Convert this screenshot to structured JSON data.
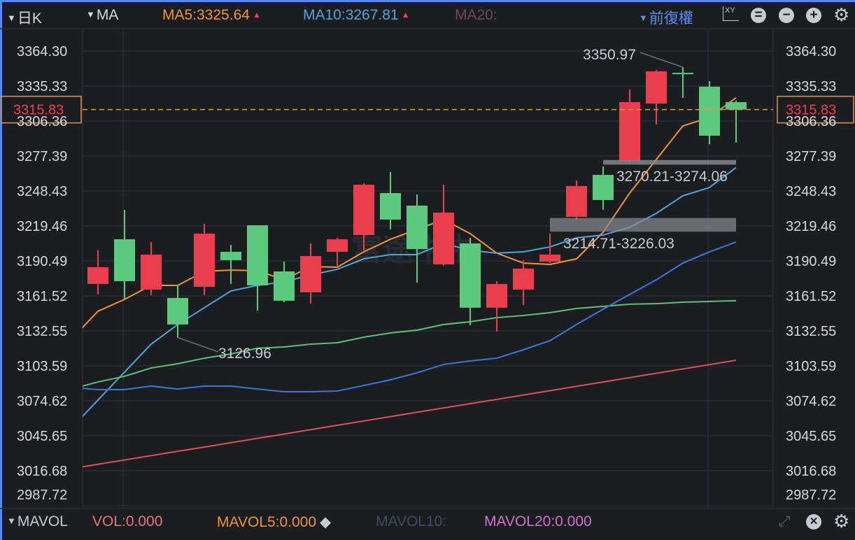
{
  "header": {
    "period": "日K",
    "indicator": "MA",
    "ma5": "MA5:3325.64",
    "ma10": "MA10:3267.81",
    "ma20": "MA20:",
    "adjust": "前復權",
    "xy_label": "XY"
  },
  "footer": {
    "indicator": "MAVOL",
    "vol": "VOL:0.000",
    "mavol5": "MAVOL5:0.000",
    "mavol10": "MAVOL10:",
    "mavol20": "MAVOL20:0.000"
  },
  "watermark": "富途牛牛",
  "colors": {
    "up": "#ea3d4d",
    "down": "#5dc97f",
    "ma5": "#f0943a",
    "ma10": "#4ea6dc",
    "ma20_label": "#6b4768",
    "accent": "#4c8cf5"
  },
  "chart_data": {
    "type": "candlestick",
    "ylim": [
      2987.72,
      3380.5
    ],
    "y_ticks": [
      "3364.30",
      "3335.33",
      "3306.36",
      "3277.39",
      "3248.43",
      "3219.46",
      "3190.49",
      "3161.52",
      "3132.55",
      "3103.59",
      "3074.62",
      "3045.65",
      "3016.68",
      "2987.72"
    ],
    "current_price": "3315.83",
    "candles": [
      {
        "o": 3171.4,
        "c": 3185.3,
        "h": 3199.2,
        "l": 3162.7
      },
      {
        "o": 3208.4,
        "c": 3173.7,
        "h": 3232.8,
        "l": 3158.6
      },
      {
        "o": 3166.7,
        "c": 3195.7,
        "h": 3206.1,
        "l": 3162.1
      },
      {
        "o": 3159.8,
        "c": 3137.8,
        "h": 3170.8,
        "l": 3126.96
      },
      {
        "o": 3169.0,
        "c": 3213.1,
        "h": 3221.2,
        "l": 3162.1
      },
      {
        "o": 3198.0,
        "c": 3191.1,
        "h": 3203.8,
        "l": 3171.4
      },
      {
        "o": 3220.0,
        "c": 3170.2,
        "h": 3220.0,
        "l": 3149.3
      },
      {
        "o": 3181.8,
        "c": 3157.5,
        "h": 3189.9,
        "l": 3156.3
      },
      {
        "o": 3164.4,
        "c": 3194.5,
        "h": 3205.0,
        "l": 3155.1
      },
      {
        "o": 3198.0,
        "c": 3208.4,
        "h": 3209.6,
        "l": 3186.4
      },
      {
        "o": 3211.9,
        "c": 3253.6,
        "h": 3254.8,
        "l": 3199.2
      },
      {
        "o": 3246.7,
        "c": 3224.7,
        "h": 3264.1,
        "l": 3216.6
      },
      {
        "o": 3236.3,
        "c": 3200.3,
        "h": 3245.5,
        "l": 3172.5
      },
      {
        "o": 3187.6,
        "c": 3230.5,
        "h": 3253.6,
        "l": 3186.4
      },
      {
        "o": 3205.0,
        "c": 3151.7,
        "h": 3209.6,
        "l": 3137.2
      },
      {
        "o": 3151.7,
        "c": 3171.4,
        "h": 3173.7,
        "l": 3132.0
      },
      {
        "o": 3166.7,
        "c": 3184.1,
        "h": 3191.1,
        "l": 3154.0
      },
      {
        "o": 3189.9,
        "c": 3195.7,
        "h": 3213.1,
        "l": 3188.7
      },
      {
        "o": 3227.0,
        "c": 3252.5,
        "h": 3257.1,
        "l": 3224.7
      },
      {
        "o": 3261.7,
        "c": 3240.9,
        "h": 3268.7,
        "l": 3232.8
      },
      {
        "o": 3273.3,
        "c": 3322.0,
        "h": 3332.4,
        "l": 3272.2
      },
      {
        "o": 3320.8,
        "c": 3347.5,
        "h": 3348.7,
        "l": 3303.5
      },
      {
        "o": 3346.3,
        "c": 3345.2,
        "h": 3350.97,
        "l": 3325.5
      },
      {
        "o": 3334.8,
        "c": 3294.2,
        "h": 3339.4,
        "l": 3287.2
      },
      {
        "o": 3322.0,
        "c": 3315.83,
        "h": 3323.2,
        "l": 3288.4
      }
    ],
    "lines": [
      {
        "name": "MA5",
        "color": "#f0943a",
        "values": [
          3125.6,
          3148.8,
          3158.6,
          3170.2,
          3170.2,
          3181.8,
          3182.9,
          3182.4,
          3174.8,
          3185.8,
          3185.3,
          3198.0,
          3208.4,
          3216.6,
          3224.7,
          3213.1,
          3196.9,
          3188.7,
          3187.6,
          3192.2,
          3214.2,
          3246.7,
          3274.5,
          3302.3,
          3309.3,
          3325.64
        ]
      },
      {
        "name": "MA10",
        "color": "#4ea6dc",
        "values": [
          3052.0,
          3075.2,
          3098.4,
          3121.5,
          3137.8,
          3151.7,
          3165.6,
          3170.2,
          3173.1,
          3178.9,
          3183.5,
          3192.2,
          3195.7,
          3195.7,
          3205.0,
          3199.2,
          3196.9,
          3198.0,
          3202.1,
          3209.6,
          3211.9,
          3218.3,
          3229.9,
          3244.4,
          3251.3,
          3267.81
        ]
      },
      {
        "name": "MA-green",
        "color": "#5cc27a",
        "values": [
          3084.4,
          3090.2,
          3094.9,
          3101.8,
          3105.3,
          3109.9,
          3113.4,
          3118.1,
          3119.2,
          3121.5,
          3122.7,
          3127.3,
          3130.8,
          3133.1,
          3137.8,
          3140.1,
          3143.5,
          3145.3,
          3147.6,
          3151.1,
          3152.8,
          3154.6,
          3155.1,
          3156.3,
          3156.9,
          3157.5
        ]
      },
      {
        "name": "MA-blue",
        "color": "#3a78e0",
        "values": [
          3085.6,
          3083.9,
          3083.9,
          3086.8,
          3084.4,
          3086.8,
          3086.8,
          3084.4,
          3082.1,
          3082.1,
          3082.7,
          3087.3,
          3092.0,
          3097.8,
          3104.7,
          3107.6,
          3109.9,
          3116.9,
          3124.4,
          3137.8,
          3150.5,
          3162.7,
          3174.8,
          3188.7,
          3198.0,
          3206.1
        ]
      },
      {
        "name": "MA-red",
        "color": "#e0505a",
        "values": [
          3018.4,
          3022.0,
          3025.6,
          3029.2,
          3032.8,
          3036.3,
          3039.9,
          3043.5,
          3047.1,
          3050.7,
          3054.3,
          3057.9,
          3061.5,
          3065.1,
          3068.7,
          3072.2,
          3075.8,
          3079.4,
          3083.0,
          3086.6,
          3090.2,
          3093.8,
          3097.4,
          3101.0,
          3104.6,
          3108.2
        ]
      }
    ],
    "annotations": {
      "max_label": "3350.97",
      "min_label": "3126.96",
      "gap1": {
        "label": "3214.71-3226.03",
        "from": 3214.71,
        "to": 3226.03,
        "start_candle": 18
      },
      "gap2": {
        "label": "3270.21-3274.06",
        "from": 3270.21,
        "to": 3274.06,
        "start_candle": 20
      }
    }
  }
}
